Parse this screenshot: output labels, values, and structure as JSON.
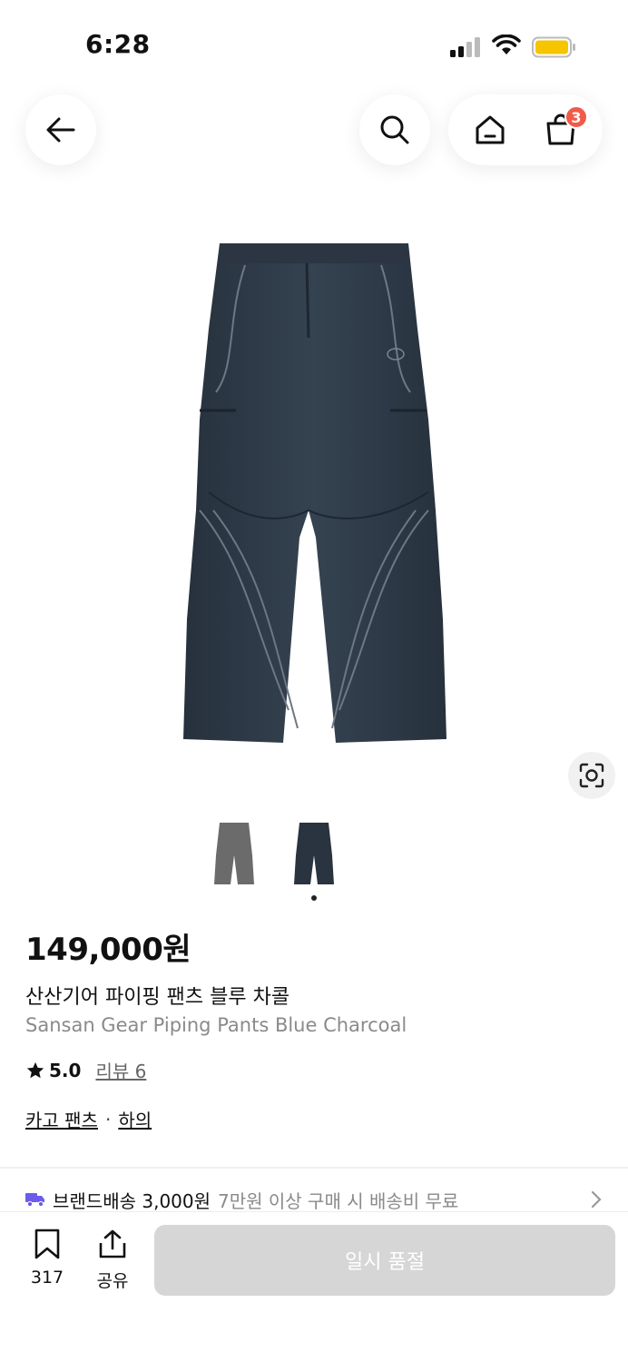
{
  "status_bar": {
    "time": "6:28"
  },
  "header": {
    "cart_count": "3"
  },
  "product": {
    "price": "149,000원",
    "name_ko": "산산기어 파이핑 팬츠 블루 차콜",
    "name_en": "Sansan Gear Piping Pants Blue Charcoal",
    "rating": "5.0",
    "review_label": "리뷰 6",
    "category_primary": "카고 팬츠",
    "category_separator": "·",
    "category_secondary": "하의",
    "colors": {
      "product": "#2f3a47",
      "grey_variant": "#6b6b6b",
      "navy_variant": "#2a3340"
    }
  },
  "shipping": {
    "label": "브랜드배송 3,000원",
    "condition": "7만원 이상 구매 시 배송비 무료"
  },
  "bottom_bar": {
    "bookmark_count": "317",
    "share_label": "공유",
    "soldout_label": "일시 품절"
  },
  "colors": {
    "badge": "#f05a4a",
    "shipping_icon": "#6c5ce7",
    "disabled_button": "#d6d6d6"
  }
}
